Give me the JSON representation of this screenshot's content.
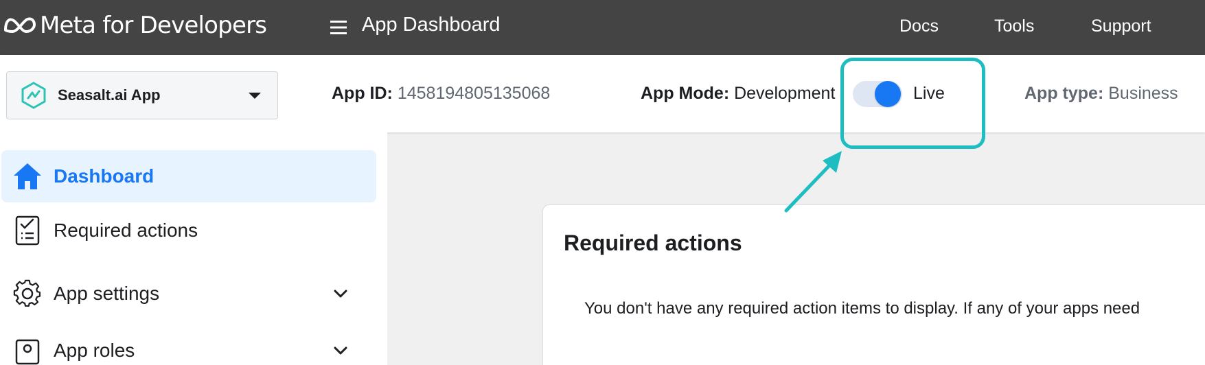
{
  "topbar": {
    "brand": "Meta for Developers",
    "title": "App Dashboard",
    "nav": [
      "Docs",
      "Tools",
      "Support"
    ]
  },
  "infobar": {
    "app_name": "Seasalt.ai App",
    "app_id_label": "App ID:",
    "app_id_value": "1458194805135068",
    "mode_label": "App Mode:",
    "mode_value": "Development",
    "toggle_label": "Live",
    "toggle_on": true,
    "type_label": "App type:",
    "type_value": "Business"
  },
  "sidebar": {
    "items": [
      {
        "label": "Dashboard",
        "active": true
      },
      {
        "label": "Required actions",
        "active": false
      },
      {
        "label": "App settings",
        "active": false
      },
      {
        "label": "App roles",
        "active": false
      }
    ]
  },
  "card": {
    "title": "Required actions",
    "text": "You don't have any required action items to display. If any of your apps need"
  },
  "colors": {
    "topbar_bg": "#444444",
    "accent_blue": "#1877f2",
    "highlight_teal": "#1ebdc2",
    "active_bg": "#e7f3ff"
  },
  "icons": [
    "meta-logo-icon",
    "hamburger-icon",
    "seasalt-logo-icon",
    "caret-down-icon",
    "home-icon",
    "checklist-icon",
    "gear-icon",
    "chevron-down-icon",
    "id-badge-icon"
  ]
}
